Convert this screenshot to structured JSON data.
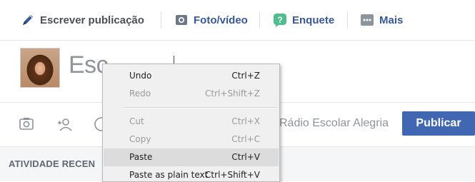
{
  "composer": {
    "tabs": [
      {
        "label": "Escrever publicação",
        "icon": "pencil-icon"
      },
      {
        "label": "Foto/vídeo",
        "icon": "camera-icon"
      },
      {
        "label": "Enquete",
        "icon": "poll-icon"
      },
      {
        "label": "Mais",
        "icon": "more-icon"
      }
    ],
    "placeholder": "Esc",
    "audience": "Rádio Escolar Alegria",
    "publish_label": "Publicar",
    "bottom_icons": [
      "photo-icon",
      "tag-friend-icon",
      "feeling-icon"
    ]
  },
  "activity": {
    "heading": "ATIVIDADE RECEN"
  },
  "context_menu": {
    "items": [
      {
        "label": "Undo",
        "shortcut": "Ctrl+Z",
        "enabled": true
      },
      {
        "label": "Redo",
        "shortcut": "Ctrl+Shift+Z",
        "enabled": false
      },
      {
        "label": "Cut",
        "shortcut": "Ctrl+X",
        "enabled": false
      },
      {
        "label": "Copy",
        "shortcut": "Ctrl+C",
        "enabled": false
      },
      {
        "label": "Paste",
        "shortcut": "Ctrl+V",
        "enabled": true,
        "highlighted": true
      },
      {
        "label": "Paste as plain text",
        "shortcut": "Ctrl+Shift+V",
        "enabled": true
      }
    ]
  },
  "colors": {
    "brand_blue": "#4267b2",
    "link_blue": "#365899",
    "poll_green": "#4fbf8f",
    "menu_bg": "#f0f0f0"
  }
}
